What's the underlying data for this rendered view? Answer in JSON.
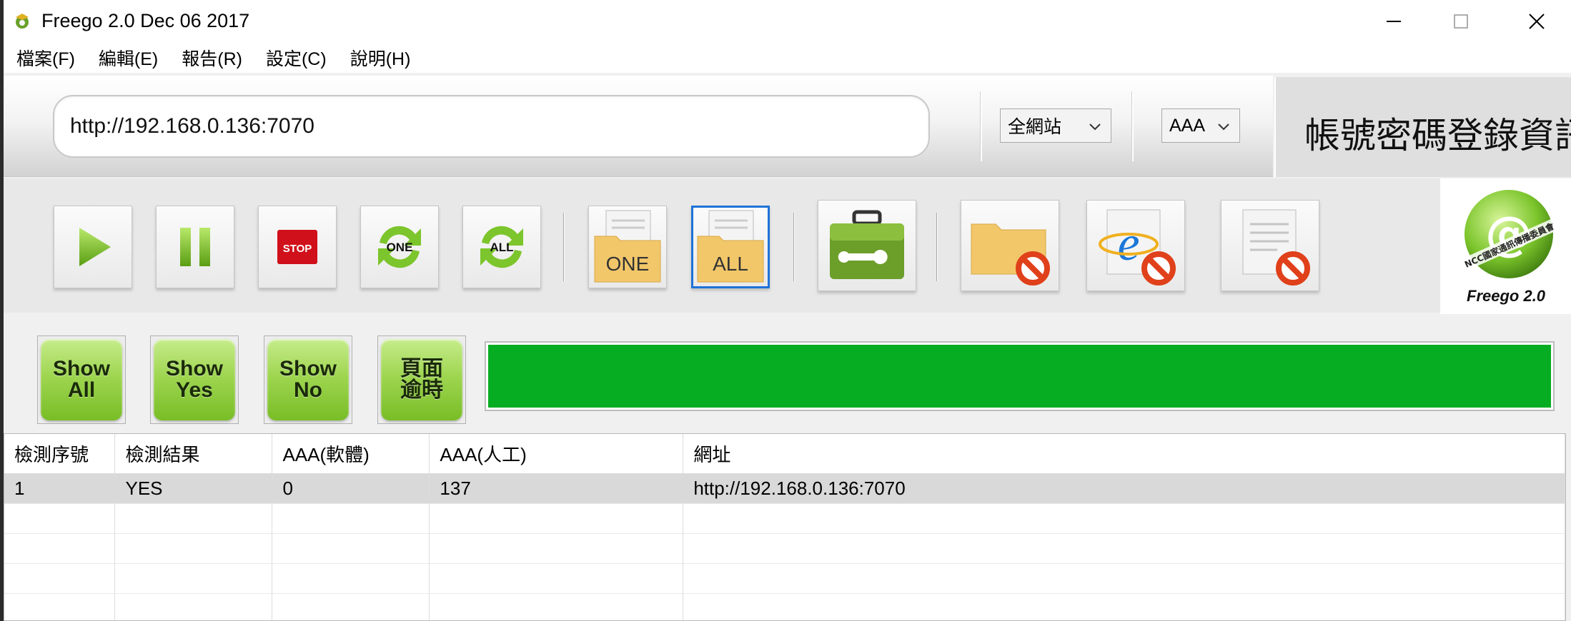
{
  "window": {
    "title": "Freego 2.0 Dec 06 2017",
    "controls": {
      "minimize": "minimize-icon",
      "maximize": "maximize-icon",
      "close": "close-icon"
    }
  },
  "menu": [
    "檔案(F)",
    "編輯(E)",
    "報告(R)",
    "設定(C)",
    "說明(H)"
  ],
  "url_bar": {
    "url": "http://192.168.0.136:7070",
    "scope_select": "全網站",
    "level_select": "AAA",
    "login_panel_label": "帳號密碼登錄資訊"
  },
  "toolbar": {
    "buttons": [
      {
        "name": "play",
        "icon": "play-icon"
      },
      {
        "name": "pause",
        "icon": "pause-icon"
      },
      {
        "name": "stop",
        "icon": "stop-icon",
        "label": "STOP"
      },
      {
        "name": "refresh-one",
        "icon": "refresh-icon",
        "label": "ONE"
      },
      {
        "name": "refresh-all",
        "icon": "refresh-icon",
        "label": "ALL"
      },
      {
        "name": "folder-one",
        "icon": "folder-doc-icon",
        "label": "ONE"
      },
      {
        "name": "folder-all",
        "icon": "folder-doc-icon",
        "label": "ALL",
        "selected": true
      },
      {
        "name": "tools",
        "icon": "toolbox-icon"
      },
      {
        "name": "no-folder",
        "icon": "folder-prohibited-icon"
      },
      {
        "name": "no-ie",
        "icon": "ie-prohibited-icon"
      },
      {
        "name": "no-doc",
        "icon": "document-prohibited-icon"
      }
    ],
    "logo_caption": "Freego 2.0",
    "logo_ring_text": "NCC國家通訊傳播委員會"
  },
  "show_buttons": [
    {
      "line1": "Show",
      "line2": "All"
    },
    {
      "line1": "Show",
      "line2": "Yes"
    },
    {
      "line1": "Show",
      "line2": "No"
    },
    {
      "line1": "頁面",
      "line2": "逾時"
    }
  ],
  "progress": {
    "percent": 100,
    "color": "#06ad22"
  },
  "table": {
    "columns": [
      "檢測序號",
      "檢測結果",
      "AAA(軟體)",
      "AAA(人工)",
      "網址"
    ],
    "rows": [
      [
        "1",
        "YES",
        "0",
        "137",
        "http://192.168.0.136:7070"
      ]
    ]
  },
  "colors": {
    "accent_selected": "#1e73d8",
    "button_green": "#9fd651",
    "progress_green": "#06ad22"
  }
}
